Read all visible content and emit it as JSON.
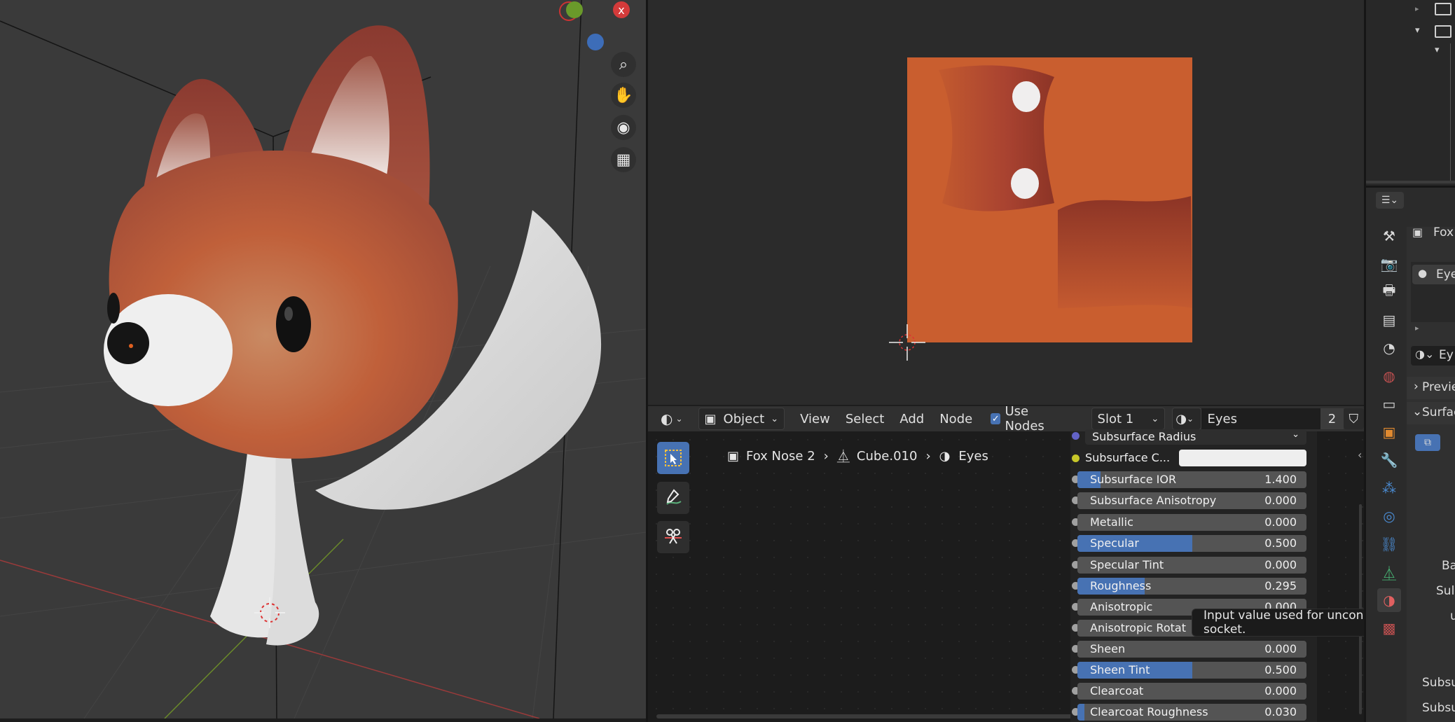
{
  "node_editor": {
    "header": {
      "mode": "Object",
      "menus": [
        "View",
        "Select",
        "Add",
        "Node"
      ],
      "use_nodes_label": "Use Nodes",
      "slot": "Slot 1",
      "material": "Eyes",
      "users_count": "2"
    },
    "breadcrumb": [
      "Fox Nose 2",
      "Cube.010",
      "Eyes"
    ],
    "properties": [
      {
        "label": "Subsurface Radius",
        "value": ""
      },
      {
        "label": "Subsurface C...",
        "value": ""
      },
      {
        "label": "Subsurface IOR",
        "value": "1.400"
      },
      {
        "label": "Subsurface Anisotropy",
        "value": "0.000"
      },
      {
        "label": "Metallic",
        "value": "0.000"
      },
      {
        "label": "Specular",
        "value": "0.500"
      },
      {
        "label": "Specular Tint",
        "value": "0.000"
      },
      {
        "label": "Roughness",
        "value": "0.295"
      },
      {
        "label": "Anisotropic",
        "value": "0.000"
      },
      {
        "label": "Anisotropic Rotat",
        "value": ""
      },
      {
        "label": "Sheen",
        "value": "0.000"
      },
      {
        "label": "Sheen Tint",
        "value": "0.500"
      },
      {
        "label": "Clearcoat",
        "value": "0.000"
      },
      {
        "label": "Clearcoat Roughness",
        "value": "0.030"
      }
    ],
    "fill_levels": {
      "Subsurface IOR": 0.1,
      "Specular": 0.5,
      "Roughness": 0.295,
      "Sheen Tint": 0.5
    },
    "tooltip": "Input value used for unconnected socket."
  },
  "properties_panel": {
    "object_name": "Fox",
    "material_slot": "Eye",
    "material_field": "Ey",
    "sections": [
      "Previe",
      "Surfac"
    ],
    "labels": [
      "Ba",
      "Sul",
      "ur",
      "Subsu",
      "Subsur"
    ]
  },
  "colors": {
    "accent": "#4772b3",
    "texture_orange": "#c95e2f",
    "fox_red": "#b5523a"
  }
}
